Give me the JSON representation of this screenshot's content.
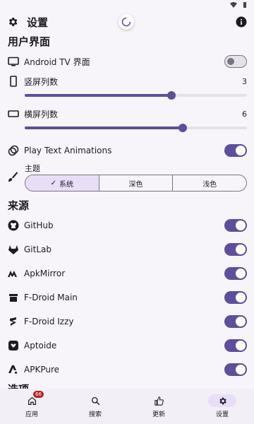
{
  "app_bar": {
    "title": "设置"
  },
  "sections": {
    "ui_title": "用户界面",
    "sources_title": "来源",
    "options_title": "选项"
  },
  "ui": {
    "android_tv": {
      "label": "Android TV 界面",
      "enabled": false
    },
    "portrait_columns": {
      "label": "竖屏列数",
      "value": "3",
      "fraction": 0.66
    },
    "landscape_columns": {
      "label": "横屏列数",
      "value": "6",
      "fraction": 0.71
    },
    "play_text_animations": {
      "label": "Play Text Animations",
      "enabled": true
    },
    "theme": {
      "label": "主题",
      "options": [
        "系统",
        "深色",
        "浅色"
      ],
      "selected": "系统"
    }
  },
  "sources": [
    {
      "label": "GitHub",
      "icon": "github-icon",
      "enabled": true
    },
    {
      "label": "GitLab",
      "icon": "gitlab-icon",
      "enabled": true
    },
    {
      "label": "ApkMirror",
      "icon": "apkmirror-icon",
      "enabled": true
    },
    {
      "label": "F-Droid Main",
      "icon": "fdroid-icon",
      "enabled": true
    },
    {
      "label": "F-Droid Izzy",
      "icon": "izzy-icon",
      "enabled": true
    },
    {
      "label": "Aptoide",
      "icon": "aptoide-icon",
      "enabled": true
    },
    {
      "label": "APKPure",
      "icon": "apkpure-icon",
      "enabled": true
    }
  ],
  "nav": {
    "apps": {
      "label": "应用",
      "badge": "66"
    },
    "search": {
      "label": "搜索"
    },
    "updates": {
      "label": "更新"
    },
    "settings": {
      "label": "设置"
    }
  },
  "colors": {
    "accent": "#5f4e99",
    "selected_bg": "#e8def8",
    "background": "#f7f5fa"
  }
}
